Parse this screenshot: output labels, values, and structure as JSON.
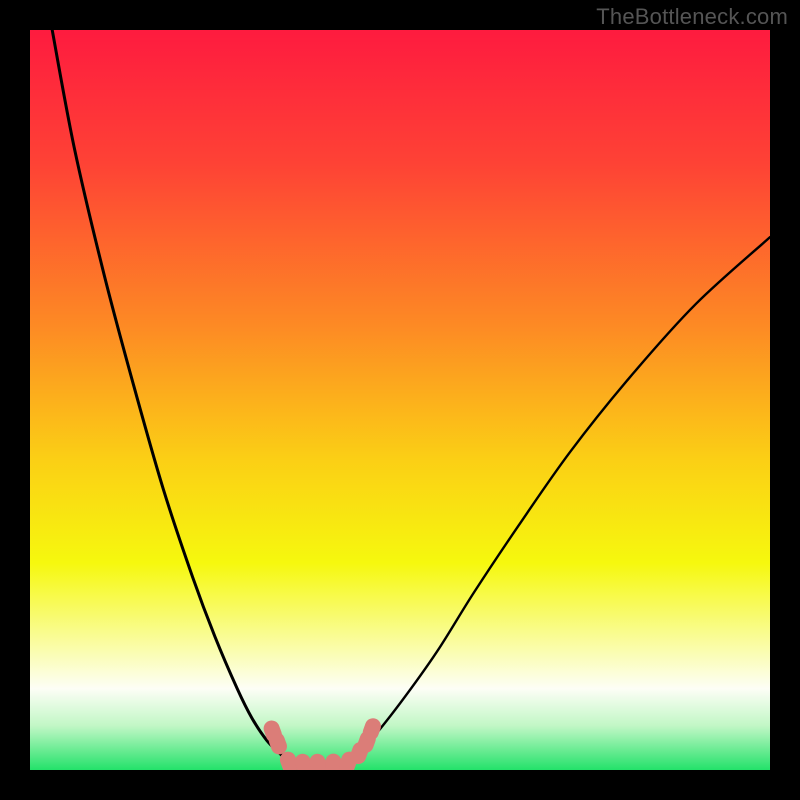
{
  "watermark": "TheBottleneck.com",
  "chart_data": {
    "type": "line",
    "title": "",
    "xlabel": "",
    "ylabel": "",
    "xlim": [
      0,
      100
    ],
    "ylim": [
      0,
      100
    ],
    "grid": false,
    "legend": false,
    "series": [
      {
        "name": "left-curve",
        "x": [
          3,
          6,
          10,
          14,
          18,
          22,
          25,
          28,
          30,
          32,
          34,
          35
        ],
        "y": [
          100,
          84,
          67,
          52,
          38,
          26,
          18,
          11,
          7,
          4,
          2,
          1
        ]
      },
      {
        "name": "right-curve",
        "x": [
          43,
          46,
          50,
          55,
          60,
          66,
          73,
          81,
          90,
          100
        ],
        "y": [
          1,
          4,
          9,
          16,
          24,
          33,
          43,
          53,
          63,
          72
        ]
      },
      {
        "name": "flat-bottom",
        "x": [
          35,
          43
        ],
        "y": [
          0.5,
          0.5
        ]
      }
    ],
    "markers": {
      "name": "points",
      "color": "#db7d78",
      "x": [
        32.8,
        33.5,
        35.0,
        37.0,
        39.0,
        41.0,
        43.0,
        44.5,
        45.5,
        46.2
      ],
      "y": [
        5.2,
        3.6,
        1.0,
        0.7,
        0.7,
        0.7,
        1.0,
        2.3,
        3.8,
        5.5
      ]
    },
    "green_band": {
      "y0": 0,
      "y1": 1.5,
      "y_fade_top": 13
    },
    "background_gradient": {
      "stops": [
        {
          "offset": 0.0,
          "color": "#fe1b3f"
        },
        {
          "offset": 0.18,
          "color": "#fe4235"
        },
        {
          "offset": 0.4,
          "color": "#fd8a24"
        },
        {
          "offset": 0.58,
          "color": "#fbcf15"
        },
        {
          "offset": 0.72,
          "color": "#f6f80e"
        },
        {
          "offset": 0.84,
          "color": "#fafdb0"
        },
        {
          "offset": 0.89,
          "color": "#fdfef6"
        },
        {
          "offset": 0.94,
          "color": "#c2f7c6"
        },
        {
          "offset": 1.0,
          "color": "#23e26a"
        }
      ]
    }
  }
}
